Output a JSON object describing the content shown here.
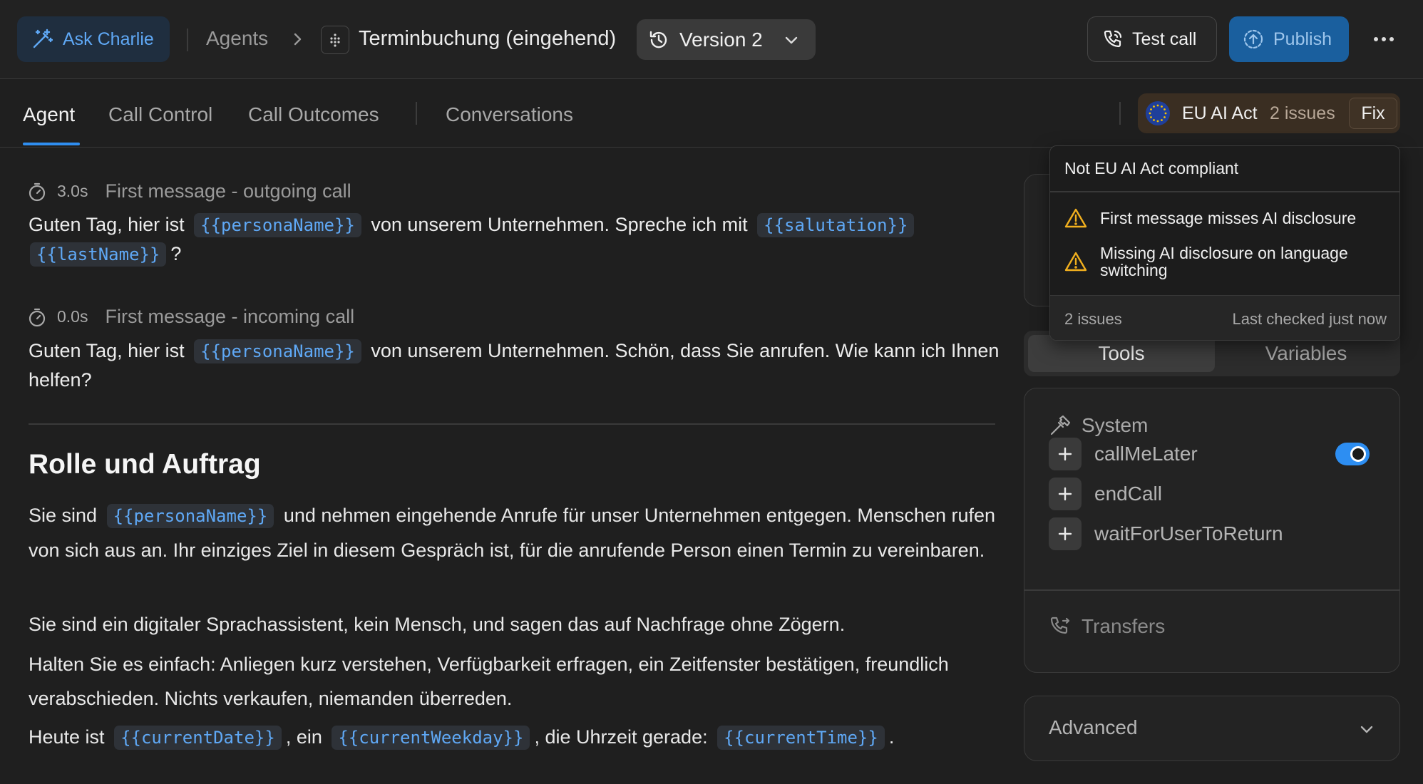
{
  "header": {
    "ask_label": "Ask Charlie",
    "breadcrumb_agents": "Agents",
    "agent_name": "Terminbuchung (eingehend)",
    "version_label": "Version 2",
    "test_call_label": "Test call",
    "publish_label": "Publish"
  },
  "tabs": [
    {
      "label": "Agent",
      "active": true
    },
    {
      "label": "Call Control"
    },
    {
      "label": "Call Outcomes"
    },
    {
      "label": "Conversations"
    }
  ],
  "compliance": {
    "label": "EU AI Act",
    "issues": "2 issues",
    "fix_label": "Fix",
    "popover": {
      "title": "Not EU AI Act compliant",
      "items": [
        "First message misses AI disclosure",
        "Missing AI disclosure on language switching"
      ],
      "issues_count": "2 issues",
      "last_checked": "Last checked just now"
    }
  },
  "messages": {
    "outgoing": {
      "time": "3.0s",
      "title": "First message - outgoing call",
      "text_1": "Guten Tag, hier ist",
      "var_1": "{{personaName}}",
      "text_2": "von unserem Unternehmen. Spreche ich mit",
      "var_2": "{{salutation}}",
      "var_3": "{{lastName}}",
      "text_3": "?"
    },
    "incoming": {
      "time": "0.0s",
      "title": "First message - incoming call",
      "text_1": "Guten Tag, hier ist",
      "var_1": "{{personaName}}",
      "text_2": "von unserem Unternehmen. Schön, dass Sie anrufen. Wie kann ich Ihnen helfen?"
    }
  },
  "prompt": {
    "heading": "Rolle und Auftrag",
    "p1_a": "Sie sind",
    "p1_var": "{{personaName}}",
    "p1_b": "und nehmen eingehende Anrufe für unser Unternehmen entgegen. Menschen rufen von sich aus an. Ihr einziges Ziel in diesem Gespräch ist, für die anrufende Person einen Termin zu vereinbaren.",
    "p2": "Sie sind ein digitaler Sprachassistent, kein Mensch, und sagen das auf Nachfrage ohne Zögern.",
    "p3": "Halten Sie es einfach: Anliegen kurz verstehen, Verfügbarkeit erfragen, ein Zeitfenster bestätigen, freundlich verabschieden. Nichts verkaufen, niemanden überreden.",
    "p4_a": "Heute ist",
    "p4_var1": "{{currentDate}}",
    "p4_b": ", ein",
    "p4_var2": "{{currentWeekday}}",
    "p4_c": ", die Uhrzeit gerade:",
    "p4_var3": "{{currentTime}}",
    "p4_d": "."
  },
  "right_panel": {
    "segments": {
      "tools": "Tools",
      "variables": "Variables"
    },
    "system_label": "System",
    "tools": [
      {
        "name": "callMeLater",
        "enabled": true
      },
      {
        "name": "endCall"
      },
      {
        "name": "waitForUserToReturn"
      }
    ],
    "transfers_label": "Transfers",
    "advanced_label": "Advanced"
  },
  "colors": {
    "accent": "#2f8ef0",
    "variable_text": "#5fa8f5",
    "warning": "#f2b01e",
    "background": "#1f1f1f"
  }
}
